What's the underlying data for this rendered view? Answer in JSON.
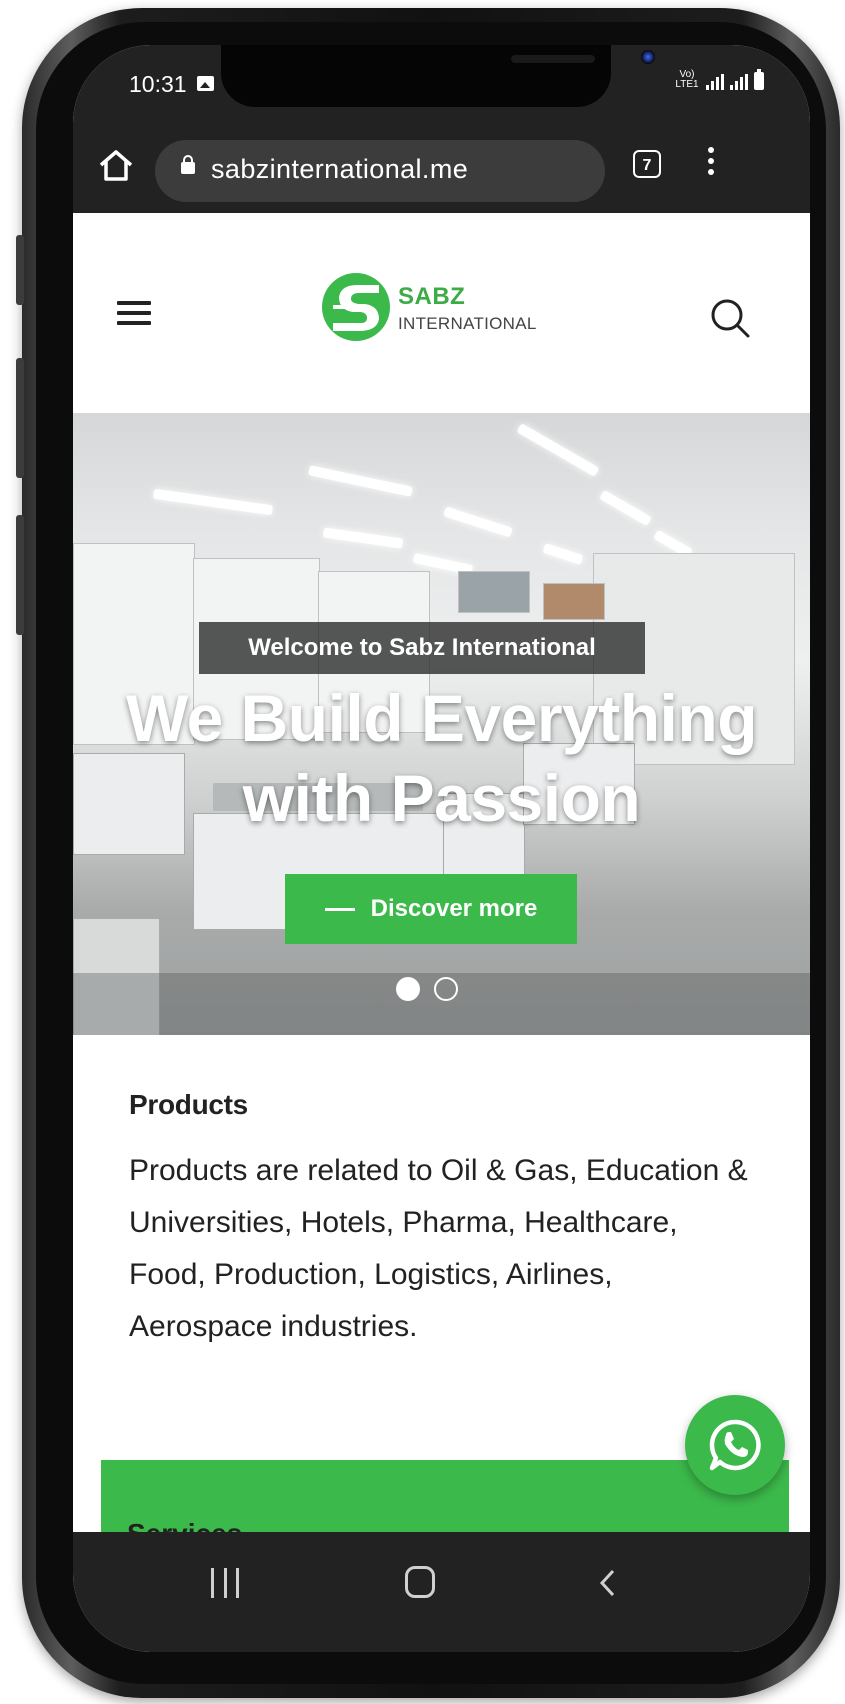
{
  "status_bar": {
    "time": "10:31",
    "network_label": "Vo) LTE1"
  },
  "browser": {
    "url": "sabzinternational.me",
    "tab_count": "7"
  },
  "site": {
    "logo_title": "SABZ",
    "logo_subtitle": "INTERNATIONAL",
    "brand_color": "#3cb94b"
  },
  "hero": {
    "kicker": "Welcome to Sabz International",
    "title_line1": "We Build Everything",
    "title_line2": "with Passion",
    "button_label": "Discover more",
    "slides": {
      "total": 2,
      "active": 1
    }
  },
  "products": {
    "heading": "Products",
    "text": "Products are related to Oil & Gas, Education & Universities, Hotels, Pharma, Healthcare, Food, Production, Logistics, Airlines, Aerospace industries."
  },
  "services": {
    "heading": "Services"
  },
  "icons": [
    "home-icon",
    "lock-icon",
    "tabs-icon",
    "more-icon",
    "hamburger-icon",
    "search-icon",
    "whatsapp-icon",
    "recents-icon",
    "home-nav-icon",
    "back-icon"
  ]
}
